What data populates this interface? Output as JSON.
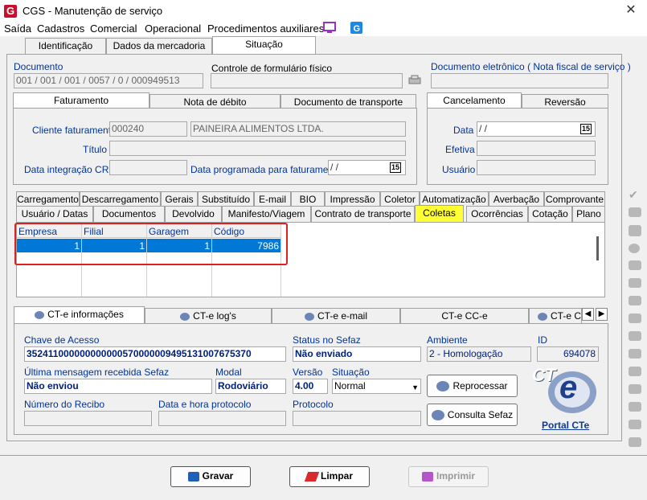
{
  "window": {
    "title": "CGS - Manutenção de serviço",
    "close": "✕",
    "logo": "G"
  },
  "menu": [
    "Saída",
    "Cadastros",
    "Comercial",
    "Operacional",
    "Procedimentos auxiliares"
  ],
  "top_tabs": [
    "Identificação",
    "Dados da mercadoria",
    "Situação"
  ],
  "documento": {
    "label": "Documento",
    "value": "001 / 001 / 001 / 0057 / 0 / 000949513"
  },
  "controle": {
    "label": "Controle de formulário físico",
    "value": ""
  },
  "doc_eletronico": {
    "label": "Documento eletrônico ( Nota fiscal de serviço )",
    "value": ""
  },
  "fat_tabs": [
    "Faturamento",
    "Nota de débito",
    "Documento de transporte"
  ],
  "cliente": {
    "label": "Cliente faturamento",
    "code": "000240",
    "name": "PAINEIRA ALIMENTOS LTDA."
  },
  "titulo": {
    "label": "Título",
    "value": ""
  },
  "data_crc": {
    "label": "Data integração CRC",
    "value": ""
  },
  "data_prog": {
    "label": "Data programada para faturamento",
    "value": " /  /",
    "cal": "15"
  },
  "canc_tabs": [
    "Cancelamento",
    "Reversão"
  ],
  "canc": {
    "data_label": "Data",
    "data_value": " /  /",
    "cal": "15",
    "efetiva_label": "Efetiva",
    "usuario_label": "Usuário"
  },
  "tabs_row1": [
    "Carregamento",
    "Descarregamento",
    "Gerais",
    "Substituído",
    "E-mail",
    "BIO",
    "Impressão",
    "Coletor",
    "Automatização",
    "Averbação",
    "Comprovante"
  ],
  "tabs_row2": [
    "Usuário / Datas",
    "Documentos",
    "Devolvido",
    "Manifesto/Viagem",
    "Contrato de transporte",
    "Coletas",
    "Ocorrências",
    "Cotação",
    "Plano"
  ],
  "coletas_table": {
    "headers": [
      "Empresa",
      "Filial",
      "Garagem",
      "Código"
    ],
    "rows": [
      [
        "1",
        "1",
        "1",
        "7986"
      ]
    ]
  },
  "cte_tabs": [
    "CT-e informações",
    "CT-e log's",
    "CT-e e-mail",
    "CT-e CC-e",
    "CT-e Ca"
  ],
  "cte": {
    "chave_label": "Chave de Acesso",
    "chave": "35241100000000000057000000949513100767537​0",
    "status_label": "Status no Sefaz",
    "status": "Não enviado",
    "ambiente_label": "Ambiente",
    "ambiente": "2 - Homologação",
    "id_label": "ID",
    "id": "694078",
    "ultima_label": "Última mensagem recebida Sefaz",
    "ultima": "Não enviou",
    "modal_label": "Modal",
    "modal": "Rodoviário",
    "versao_label": "Versão",
    "versao": "4.00",
    "situacao_label": "Situação",
    "situacao": "Normal",
    "recibo_label": "Número do Recibo",
    "recibo": "",
    "data_protocolo_label": "Data e hora protocolo",
    "data_protocolo": "",
    "protocolo_label": "Protocolo",
    "protocolo": "",
    "reprocessar": "Reprocessar",
    "consulta": "Consulta Sefaz",
    "portal": "Portal CTe",
    "logo_text": "CT",
    "logo_e": "e"
  },
  "buttons": {
    "gravar": "Gravar",
    "limpar": "Limpar",
    "imprimir": "Imprimir"
  },
  "colors": {
    "highlight_tab": "#ffff33",
    "selected_row": "#0078d7",
    "red_box": "#e02020",
    "blue_text": "#003399"
  }
}
